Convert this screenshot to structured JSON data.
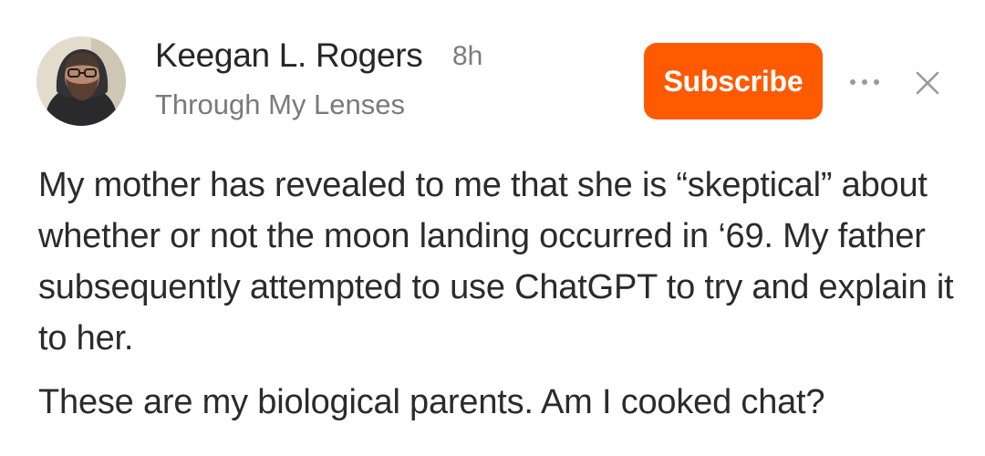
{
  "header": {
    "author_name": "Keegan L. Rogers",
    "time_ago": "8h",
    "publication": "Through My Lenses",
    "subscribe_label": "Subscribe",
    "accent_color": "#ff5a00",
    "more_icon": "more-horizontal-icon",
    "close_icon": "close-icon"
  },
  "post": {
    "paragraphs": [
      "My mother has revealed to me that she is “skeptical” about whether or not the moon landing occurred in ‘69. My father subsequently attempted to use ChatGPT to try and explain it to her.",
      "These are my biological parents. Am I cooked chat?"
    ]
  }
}
